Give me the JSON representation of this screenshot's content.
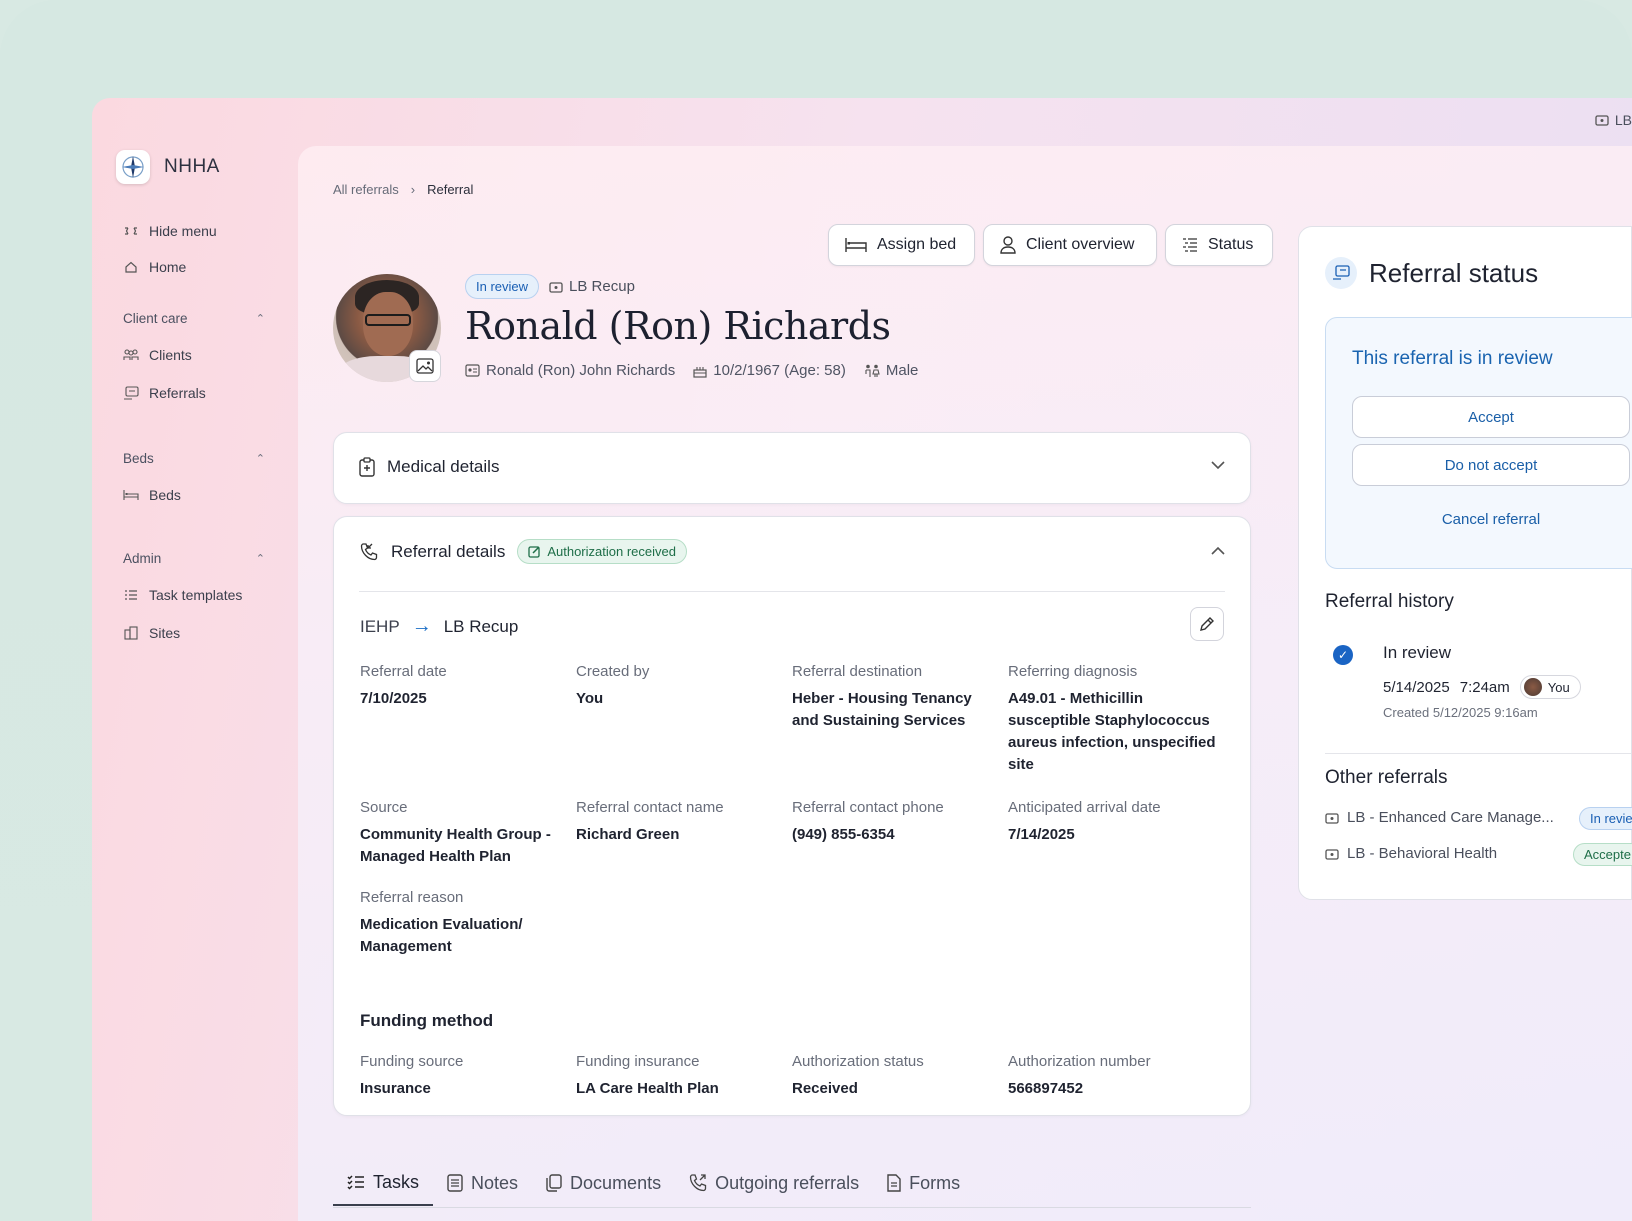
{
  "brand": {
    "name": "NHHA"
  },
  "top_chip": {
    "label": "LB"
  },
  "sidebar": {
    "hide_menu": "Hide menu",
    "home": "Home",
    "groups": [
      {
        "label": "Client care",
        "items": [
          "Clients",
          "Referrals"
        ]
      },
      {
        "label": "Beds",
        "items": [
          "Beds"
        ]
      },
      {
        "label": "Admin",
        "items": [
          "Task templates",
          "Sites"
        ]
      }
    ]
  },
  "breadcrumb": {
    "root": "All referrals",
    "current": "Referral"
  },
  "toolbar": {
    "assign_bed": "Assign bed",
    "client_overview": "Client overview",
    "status": "Status"
  },
  "patient": {
    "status_pill": "In review",
    "site": "LB Recup",
    "name": "Ronald (Ron) Richards",
    "full_name": "Ronald (Ron) John Richards",
    "dob": "10/2/1967 (Age: 58)",
    "gender": "Male"
  },
  "medical": {
    "title": "Medical details"
  },
  "referral": {
    "title": "Referral details",
    "auth_pill": "Authorization received",
    "from": "IEHP",
    "to": "LB Recup",
    "fields": [
      {
        "label": "Referral date",
        "value": "7/10/2025"
      },
      {
        "label": "Created by",
        "value": "You"
      },
      {
        "label": "Referral destination",
        "value": "Heber - Housing Tenancy and Sustaining Services"
      },
      {
        "label": "Referring diagnosis",
        "value": "A49.01 - Methicillin susceptible Staphylococcus aureus infection, unspecified site"
      },
      {
        "label": "Source",
        "value": "Community Health Group - Managed Health Plan"
      },
      {
        "label": "Referral contact name",
        "value": "Richard Green"
      },
      {
        "label": "Referral contact phone",
        "value": "(949) 855-6354"
      },
      {
        "label": "Anticipated arrival date",
        "value": "7/14/2025"
      },
      {
        "label": "Referral reason",
        "value": "Medication Evaluation/ Management"
      }
    ],
    "funding_title": "Funding method",
    "funding": [
      {
        "label": "Funding source",
        "value": "Insurance"
      },
      {
        "label": "Funding insurance",
        "value": "LA Care Health Plan"
      },
      {
        "label": "Authorization status",
        "value": "Received"
      },
      {
        "label": "Authorization number",
        "value": "566897452"
      }
    ]
  },
  "tabs": [
    "Tasks",
    "Notes",
    "Documents",
    "Outgoing referrals",
    "Forms"
  ],
  "status_panel": {
    "title": "Referral status",
    "review_title": "This referral is in review",
    "accept": "Accept",
    "do_not_accept": "Do not accept",
    "cancel": "Cancel referral",
    "history_title": "Referral history",
    "history": {
      "status": "In review",
      "date": "5/14/2025",
      "time": "7:24am",
      "by": "You",
      "created": "Created 5/12/2025  9:16am"
    },
    "other_title": "Other referrals",
    "other": [
      {
        "label": "LB - Enhanced Care Manage...",
        "status": "In revie"
      },
      {
        "label": "LB - Behavioral Health",
        "status": "Accepte"
      }
    ]
  }
}
